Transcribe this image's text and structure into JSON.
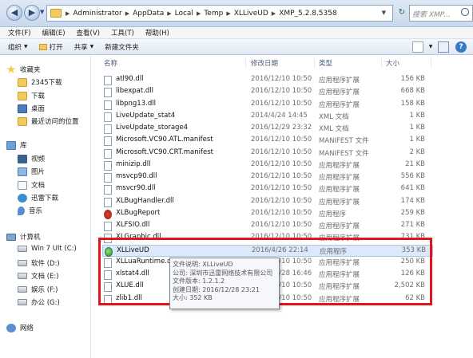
{
  "address": {
    "crumbs": [
      "Administrator",
      "AppData",
      "Local",
      "Temp",
      "XLLiveUD",
      "XMP_5.2.8.5358"
    ],
    "search_placeholder": "搜索 XMP..."
  },
  "menu": [
    "文件(F)",
    "编辑(E)",
    "查看(V)",
    "工具(T)",
    "帮助(H)"
  ],
  "toolbar": {
    "organize": "组织",
    "open": "打开",
    "share": "共享",
    "new_folder": "新建文件夹"
  },
  "nav": {
    "favorites": "收藏夹",
    "fav_items": [
      "2345下载",
      "下载",
      "桌面",
      "最近访问的位置"
    ],
    "libraries": "库",
    "lib_items": [
      "视频",
      "图片",
      "文档",
      "迅雷下载",
      "音乐"
    ],
    "computer": "计算机",
    "drives": [
      "Win 7 Ult (C:)",
      "软件 (D:)",
      "文档 (E:)",
      "娱乐 (F:)",
      "办公 (G:)"
    ],
    "network": "网络"
  },
  "columns": {
    "name": "名称",
    "date": "修改日期",
    "type": "类型",
    "size": "大小"
  },
  "files": [
    {
      "name": "atl90.dll",
      "date": "2016/12/10 10:50",
      "type": "应用程序扩展",
      "size": "156 KB",
      "icon": "dll"
    },
    {
      "name": "libexpat.dll",
      "date": "2016/12/10 10:50",
      "type": "应用程序扩展",
      "size": "668 KB",
      "icon": "dll"
    },
    {
      "name": "libpng13.dll",
      "date": "2016/12/10 10:50",
      "type": "应用程序扩展",
      "size": "158 KB",
      "icon": "dll"
    },
    {
      "name": "LiveUpdate_stat4",
      "date": "2014/4/24 14:45",
      "type": "XML 文档",
      "size": "1 KB",
      "icon": "xml"
    },
    {
      "name": "LiveUpdate_storage4",
      "date": "2016/12/29 23:32",
      "type": "XML 文档",
      "size": "1 KB",
      "icon": "xml"
    },
    {
      "name": "Microsoft.VC90.ATL.manifest",
      "date": "2016/12/10 10:50",
      "type": "MANIFEST 文件",
      "size": "1 KB",
      "icon": "file"
    },
    {
      "name": "Microsoft.VC90.CRT.manifest",
      "date": "2016/12/10 10:50",
      "type": "MANIFEST 文件",
      "size": "2 KB",
      "icon": "file"
    },
    {
      "name": "minizip.dll",
      "date": "2016/12/10 10:50",
      "type": "应用程序扩展",
      "size": "21 KB",
      "icon": "dll"
    },
    {
      "name": "msvcp90.dll",
      "date": "2016/12/10 10:50",
      "type": "应用程序扩展",
      "size": "556 KB",
      "icon": "dll"
    },
    {
      "name": "msvcr90.dll",
      "date": "2016/12/10 10:50",
      "type": "应用程序扩展",
      "size": "641 KB",
      "icon": "dll"
    },
    {
      "name": "XLBugHandler.dll",
      "date": "2016/12/10 10:50",
      "type": "应用程序扩展",
      "size": "174 KB",
      "icon": "dll"
    },
    {
      "name": "XLBugReport",
      "date": "2016/12/10 10:50",
      "type": "应用程序",
      "size": "259 KB",
      "icon": "bug"
    },
    {
      "name": "XLFSIO.dll",
      "date": "2016/12/10 10:50",
      "type": "应用程序扩展",
      "size": "271 KB",
      "icon": "dll"
    },
    {
      "name": "XLGraphic.dll",
      "date": "2016/12/10 10:50",
      "type": "应用程序扩展",
      "size": "731 KB",
      "icon": "dll"
    },
    {
      "name": "XLLiveUD",
      "date": "2016/4/26 22:14",
      "type": "应用程序",
      "size": "353 KB",
      "icon": "app",
      "selected": true
    },
    {
      "name": "XLLuaRuntime.dll",
      "date": "2016/12/10 10:50",
      "type": "应用程序扩展",
      "size": "250 KB",
      "icon": "dll"
    },
    {
      "name": "xlstat4.dll",
      "date": "2016/12/28 16:46",
      "type": "应用程序扩展",
      "size": "126 KB",
      "icon": "dll"
    },
    {
      "name": "XLUE.dll",
      "date": "2016/12/10 10:50",
      "type": "应用程序扩展",
      "size": "2,502 KB",
      "icon": "dll"
    },
    {
      "name": "zlib1.dll",
      "date": "2016/12/10 10:50",
      "type": "应用程序扩展",
      "size": "62 KB",
      "icon": "dll"
    }
  ],
  "tooltip": {
    "desc": "文件说明: XLLiveUD",
    "company": "公司: 深圳市迅雷网络技术有限公司",
    "version": "文件版本: 1.2.1.2",
    "created": "创建日期: 2016/12/28 23:21",
    "size": "大小: 352 KB"
  }
}
